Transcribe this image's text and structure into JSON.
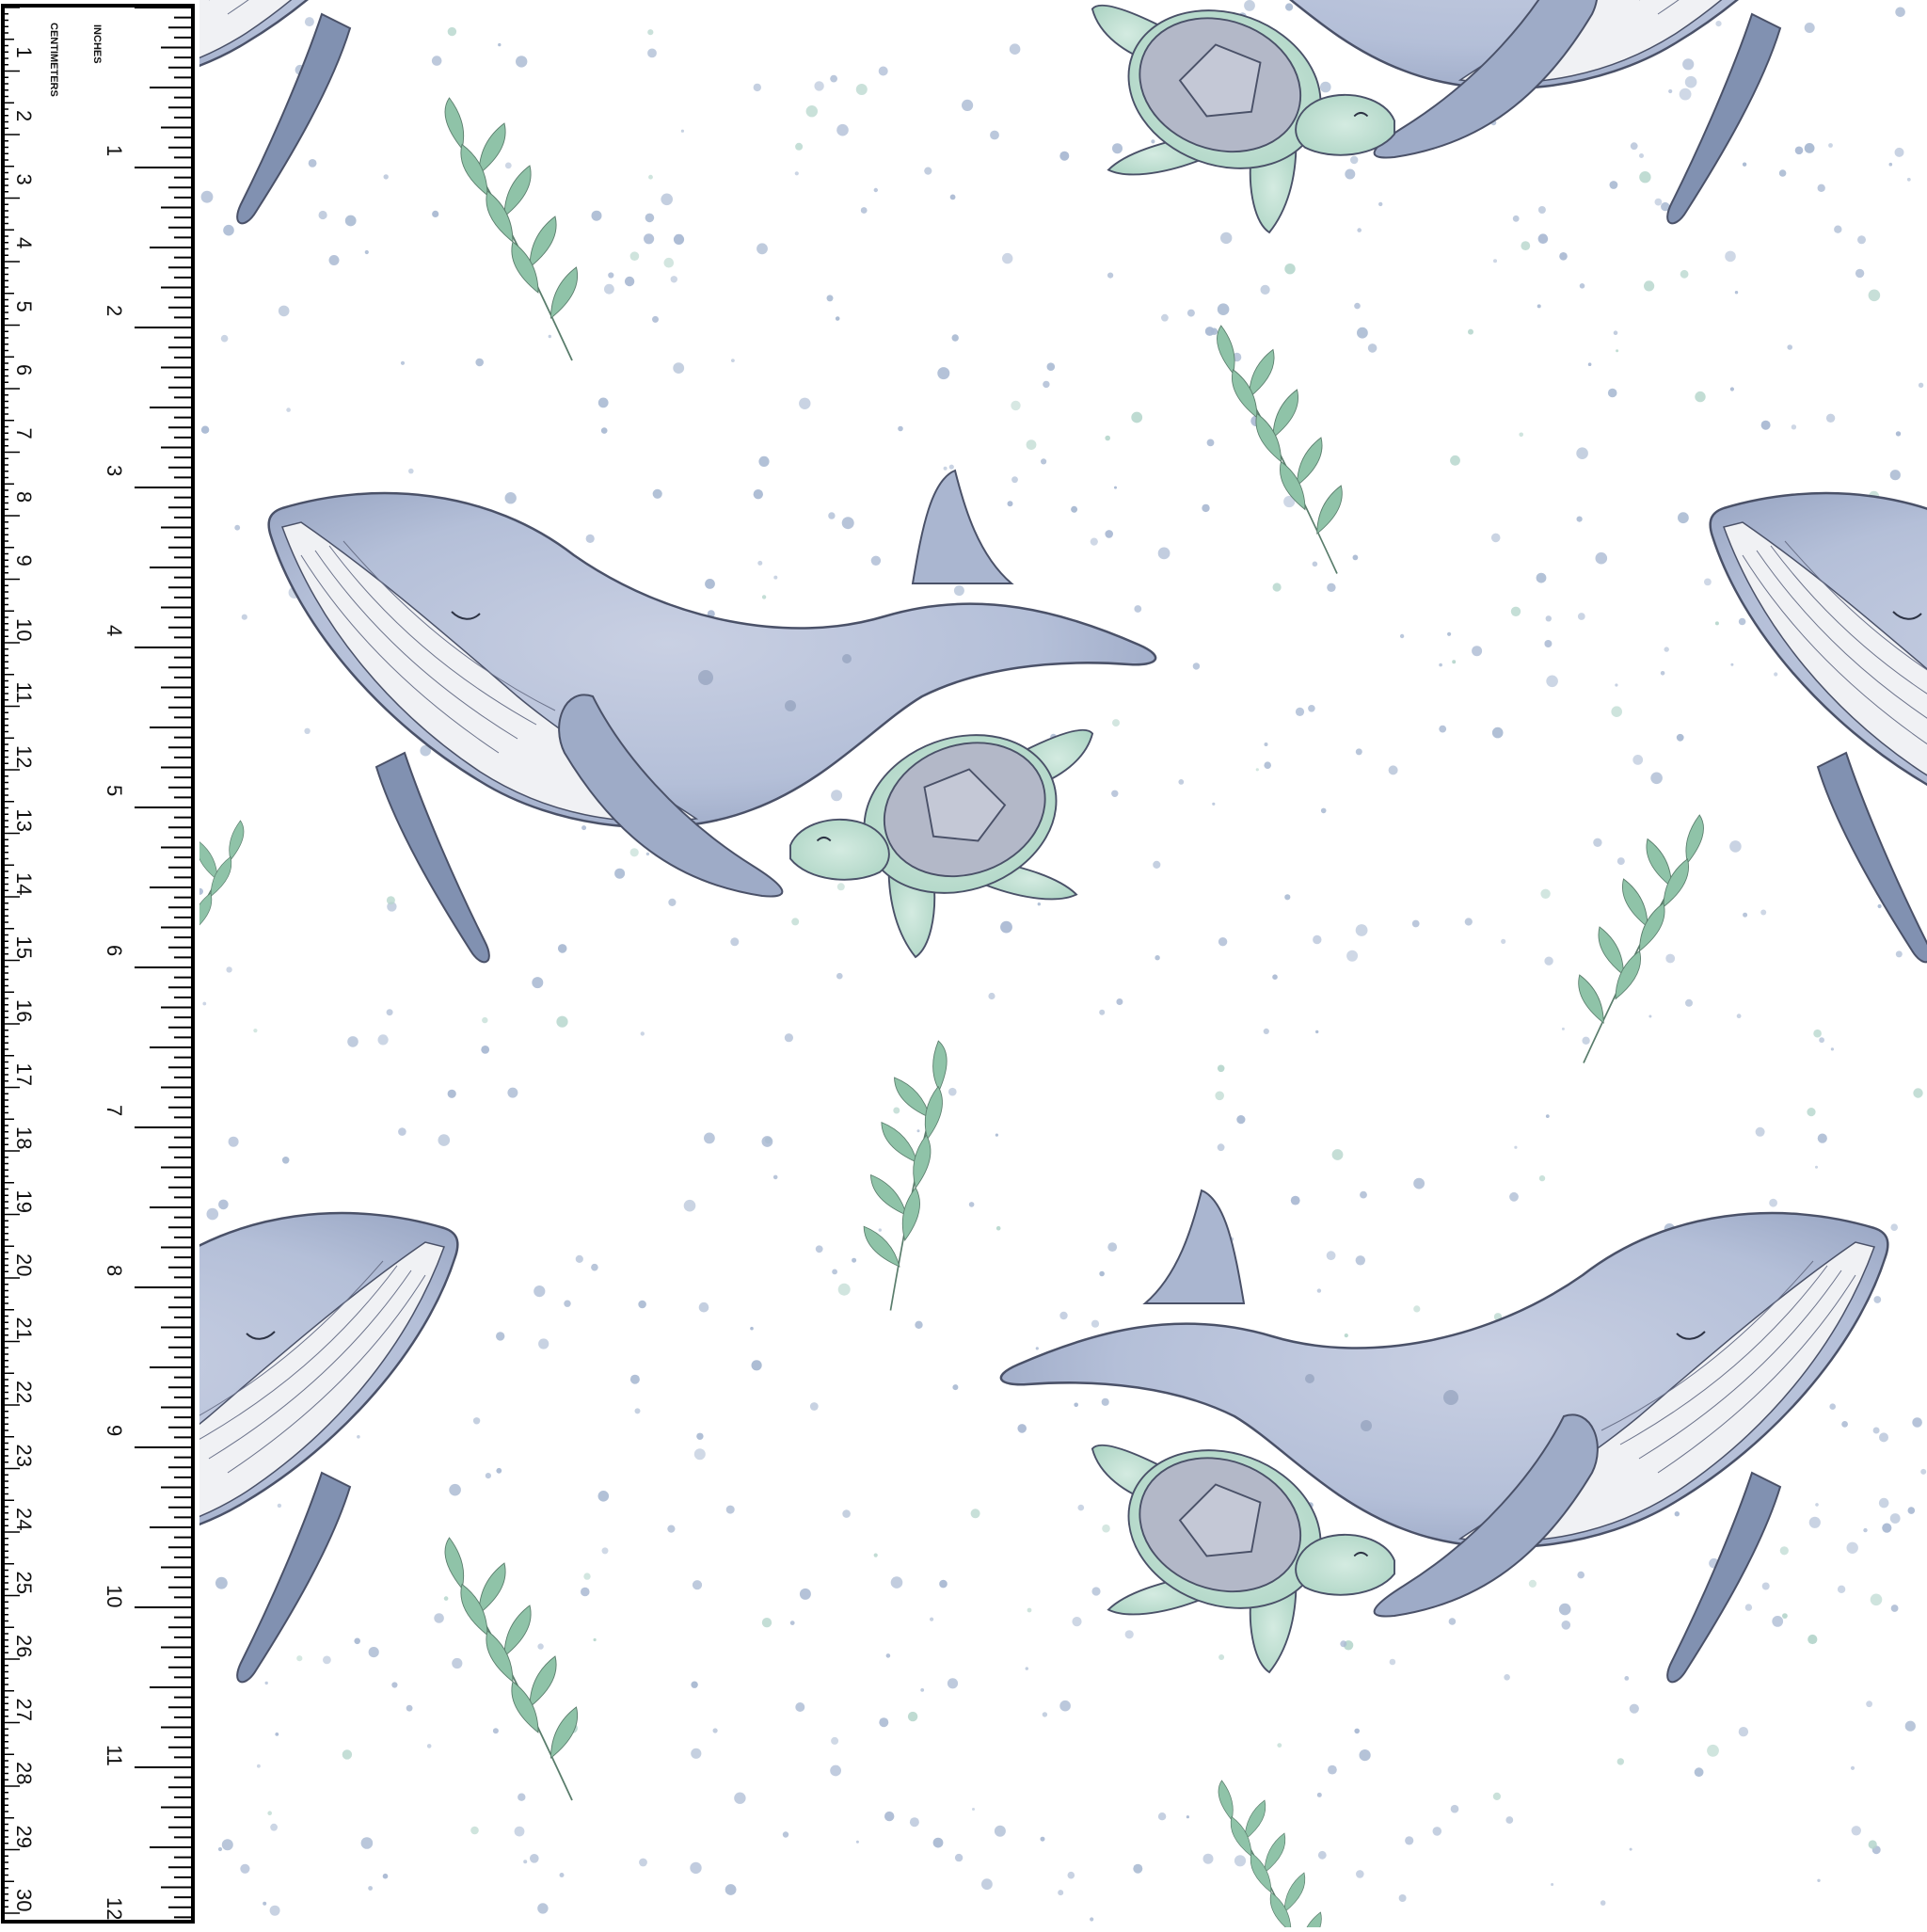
{
  "ruler": {
    "units_label_cm": "CENTIMETERS",
    "units_label_in": "INCHES",
    "cm_numbers": [
      "1",
      "2",
      "3",
      "4",
      "5",
      "6",
      "7",
      "8",
      "9",
      "10",
      "11",
      "12",
      "13",
      "14",
      "15",
      "16",
      "17",
      "18",
      "19",
      "20",
      "21",
      "22",
      "23",
      "24",
      "25",
      "26",
      "27",
      "28",
      "29",
      "30"
    ],
    "inch_numbers": [
      "1",
      "2",
      "3",
      "4",
      "5",
      "6",
      "7",
      "8",
      "9",
      "10",
      "11",
      "12"
    ]
  },
  "fabric": {
    "background_color": "#ffffff",
    "motifs": [
      "humpback-whale",
      "sea-turtle",
      "seaweed-sprig",
      "speckle-dots"
    ],
    "colors": {
      "whale_body": "#b4bfd8",
      "whale_dark": "#7f8fae",
      "whale_belly": "#f0f1f4",
      "turtle_body": "#bcdccf",
      "turtle_shell": "#b3b8c8",
      "leaf": "#8fc3a8",
      "dots": "#a9b9d2",
      "outline": "#4a5168"
    }
  }
}
